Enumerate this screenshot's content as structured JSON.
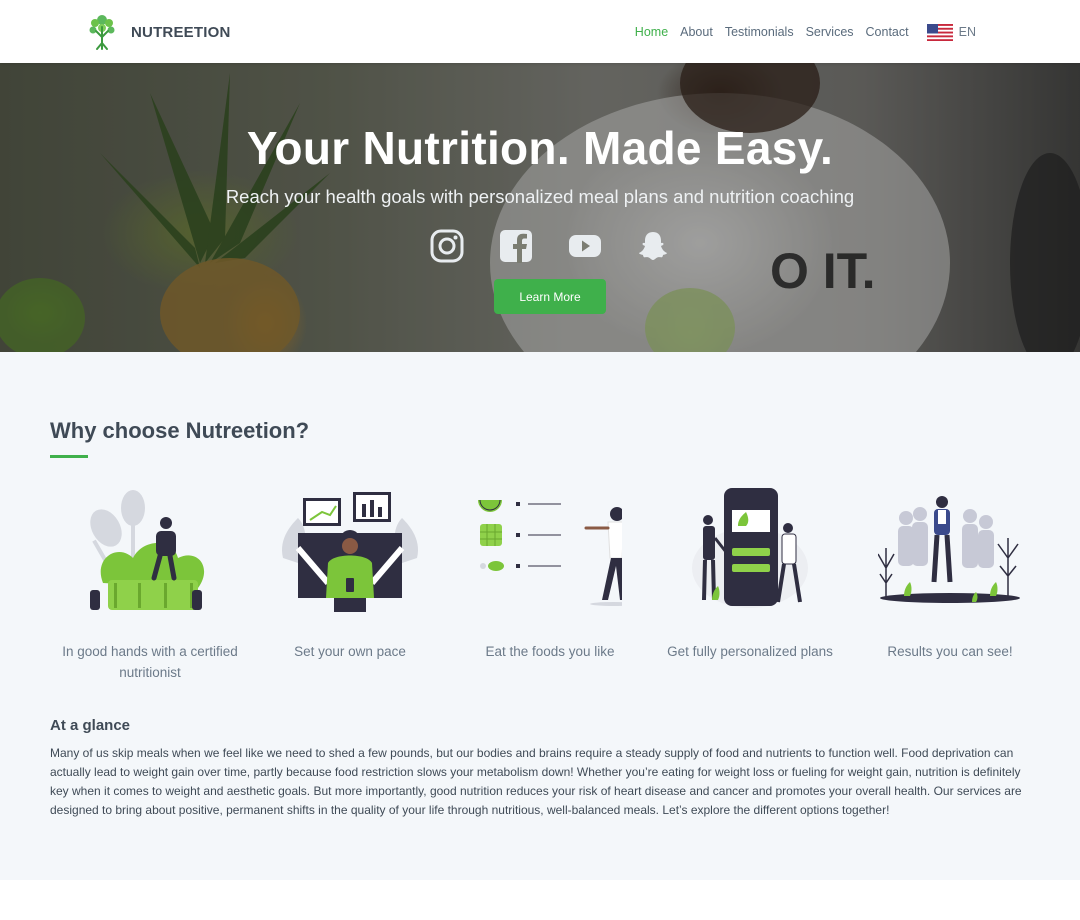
{
  "brand": {
    "name": "NUTREETION",
    "logo_icon": "tree-logo-icon"
  },
  "nav": {
    "links": [
      {
        "label": "Home",
        "active": true
      },
      {
        "label": "About",
        "active": false
      },
      {
        "label": "Testimonials",
        "active": false
      },
      {
        "label": "Services",
        "active": false
      },
      {
        "label": "Contact",
        "active": false
      }
    ],
    "language": {
      "label": "EN",
      "flag_icon": "us-flag-icon"
    }
  },
  "hero": {
    "title": "Your Nutrition. Made Easy.",
    "subtitle": "Reach your health goals with personalized meal plans and nutrition coaching",
    "socials": [
      "instagram-icon",
      "facebook-icon",
      "youtube-icon",
      "snapchat-icon"
    ],
    "cta_label": "Learn More"
  },
  "why": {
    "title": "Why choose Nutreetion?",
    "features": [
      {
        "caption": "In good hands with a certified nutritionist",
        "icon": "nutritionist-illustration"
      },
      {
        "caption": "Set your own pace",
        "icon": "own-pace-illustration"
      },
      {
        "caption": "Eat the foods you like",
        "icon": "foods-illustration"
      },
      {
        "caption": "Get fully personalized plans",
        "icon": "personalized-plans-illustration"
      },
      {
        "caption": "Results you can see!",
        "icon": "results-illustration"
      }
    ]
  },
  "glance": {
    "title": "At a glance",
    "text": "Many of us skip meals when we feel like we need to shed a few pounds, but our bodies and brains require a steady supply of food and nutrients to function well. Food deprivation can actually lead to weight gain over time, partly because food restriction slows your metabolism down! Whether you’re eating for weight loss or fueling for weight gain, nutrition is definitely key when it comes to weight and aesthetic goals. But more importantly, good nutrition reduces your risk of heart disease and cancer and promotes your overall health. Our services are designed to bring about positive, permanent shifts in the quality of your life through nutritious, well-balanced meals. Let’s explore the different options together!"
  },
  "colors": {
    "accent": "#3fb04b",
    "heading": "#3f4a56",
    "muted": "#6c7a89",
    "section_bg": "#f4f7fa"
  }
}
